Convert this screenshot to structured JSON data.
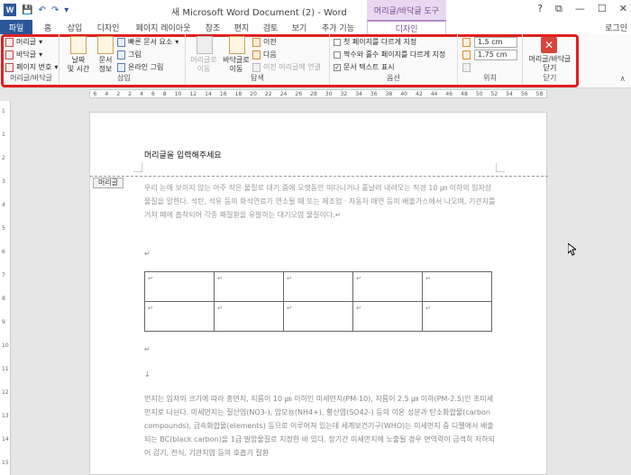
{
  "titlebar": {
    "title": "새 Microsoft Word Document (2) - Word",
    "context_tool": "머리글/바닥글 도구",
    "win_controls": [
      "?",
      "⧉",
      "—",
      "☐",
      "✕"
    ]
  },
  "tabs": [
    {
      "label": "파일"
    },
    {
      "label": "홈"
    },
    {
      "label": "삽입"
    },
    {
      "label": "디자인"
    },
    {
      "label": "페이지 레이아웃"
    },
    {
      "label": "참조"
    },
    {
      "label": "편지"
    },
    {
      "label": "검토"
    },
    {
      "label": "보기"
    },
    {
      "label": "추가 기능"
    },
    {
      "label": "디자인"
    }
  ],
  "login": "로그인",
  "ribbon": {
    "hf_group": {
      "header": "머리글",
      "footer": "바닥글",
      "page_number": "페이지 번호",
      "label": "머리글/바닥글"
    },
    "insert_group": {
      "date_time": "날짜\n및 시간",
      "doc_info": "문서\n정보",
      "quick_parts": "빠른 문서 요소",
      "picture": "그림",
      "online_picture": "온라인 그림",
      "label": "삽입"
    },
    "nav_group": {
      "goto_header": "머리글로\n이동",
      "goto_footer": "바닥글로\n이동",
      "prev": "이전",
      "next": "다음",
      "link_prev": "이전 머리글에 연결",
      "label": "탐색"
    },
    "options_group": {
      "diff_first": "첫 페이지를 다르게 지정",
      "diff_odd_even": "짝수와 홀수 페이지를 다르게 지정",
      "show_doc_text": "문서 텍스트 표시",
      "label": "옵션"
    },
    "position_group": {
      "header_pos": "1.5 cm",
      "footer_pos": "1.75 cm",
      "label": "위치"
    },
    "close_group": {
      "close": "머리글/바닥글\n닫기",
      "label": "닫기"
    }
  },
  "ruler": [
    "6",
    "4",
    "2",
    "2",
    "4",
    "6",
    "8",
    "10",
    "12",
    "14",
    "16",
    "18",
    "20",
    "22",
    "24",
    "26",
    "28",
    "30",
    "32",
    "34",
    "36",
    "38",
    "40",
    "42",
    "44",
    "46",
    "48",
    "50",
    "52",
    "54",
    "56",
    "58"
  ],
  "vruler": [
    "1",
    "1",
    "2",
    "3",
    "4",
    "5",
    "6",
    "7",
    "8",
    "9",
    "10",
    "11",
    "12",
    "13",
    "14",
    "15"
  ],
  "document": {
    "header_text": "머리글을 입력해주세요",
    "header_tag": "머리글",
    "para1": "우리 눈에 보이지 않는 아주 작은 물질로 대기 중에 오랫동안 떠다니거나 흩날려 내려오는 직경 10 ㎛ 이하의 입자상 물질을 말한다. 석탄, 석유 등의 화석연료가 연소될 때 또는 제조업 · 자동차 매연 등의 배출가스에서 나오며, 기관지를 거쳐 폐에 흡착되어 각종 폐질환을 유발하는 대기오염 물질이다.↵",
    "mark1": "↵",
    "table": [
      [
        "↵",
        "↵",
        "↵",
        "↵",
        "↵"
      ],
      [
        "↵",
        "↵",
        "↵",
        "↵",
        "↵"
      ]
    ],
    "mark2": "↵",
    "mark3": "↓",
    "para2": "먼지는 입자의 크기에 따라 총먼지, 지름이 10 ㎛ 이하인 미세먼지(PM-10), 지름이 2.5 ㎛ 이하(PM-2.5)인 초미세먼지로 나뉜다. 미세먼지는 질산염(NO3-), 암모늄(NH4+), 황산염(SO42-) 등의 이온 성분과 탄소화합물(carbon compounds), 금속화합물(elements) 등으로 이루어져 있는데 세계보건기구(WHO)는 미세먼지 중 디젤에서 배출되는 BC(black carbon)을 1급 발암물질로 지정한 바 있다. 장기간 미세먼지에 노출될 경우 면역력이 급격히 저하되어 감기, 천식, 기관지염 등의 호흡기 질환"
  }
}
